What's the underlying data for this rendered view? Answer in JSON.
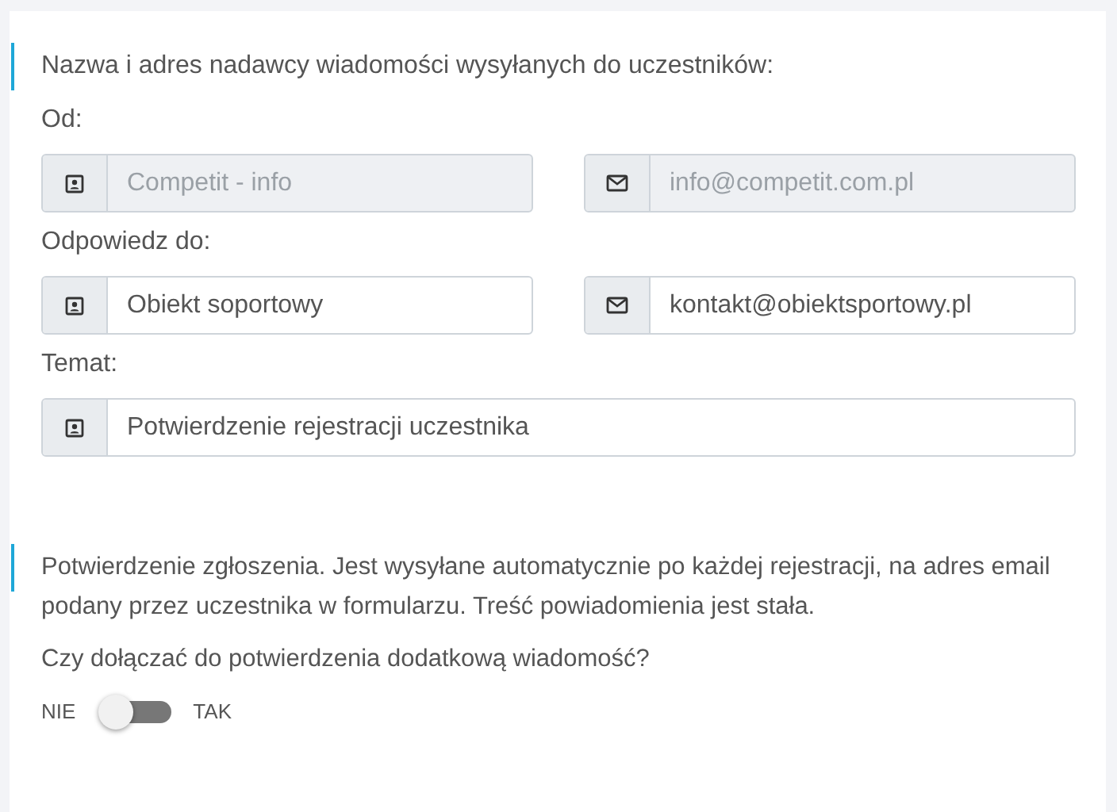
{
  "sender_section": {
    "heading": "Nazwa i adres nadawcy wiadomości wysyłanych do uczestników:",
    "groups": [
      {
        "label": "Od:",
        "fields": [
          {
            "kind": "person",
            "value": "Competit - info",
            "disabled": true
          },
          {
            "kind": "email",
            "value": "info@competit.com.pl",
            "disabled": true
          }
        ]
      },
      {
        "label": "Odpowiedz do:",
        "fields": [
          {
            "kind": "person",
            "value": "Obiekt soportowy",
            "disabled": false
          },
          {
            "kind": "email",
            "value": "kontakt@obiektsportowy.pl",
            "disabled": false
          }
        ]
      },
      {
        "label": "Temat:",
        "fields": [
          {
            "kind": "person",
            "value": "Potwierdzenie rejestracji uczestnika",
            "disabled": false
          }
        ]
      }
    ]
  },
  "confirmation_section": {
    "description": "Potwierdzenie zgłoszenia. Jest wysyłane automatycznie po każdej rejestracji, na adres email podany przez uczestnika w formularzu. Treść powiadomienia jest stała.",
    "question": "Czy dołączać do potwierdzenia dodatkową wiadomość?",
    "toggle": {
      "off_label": "NIE",
      "on_label": "TAK",
      "on": false
    }
  }
}
